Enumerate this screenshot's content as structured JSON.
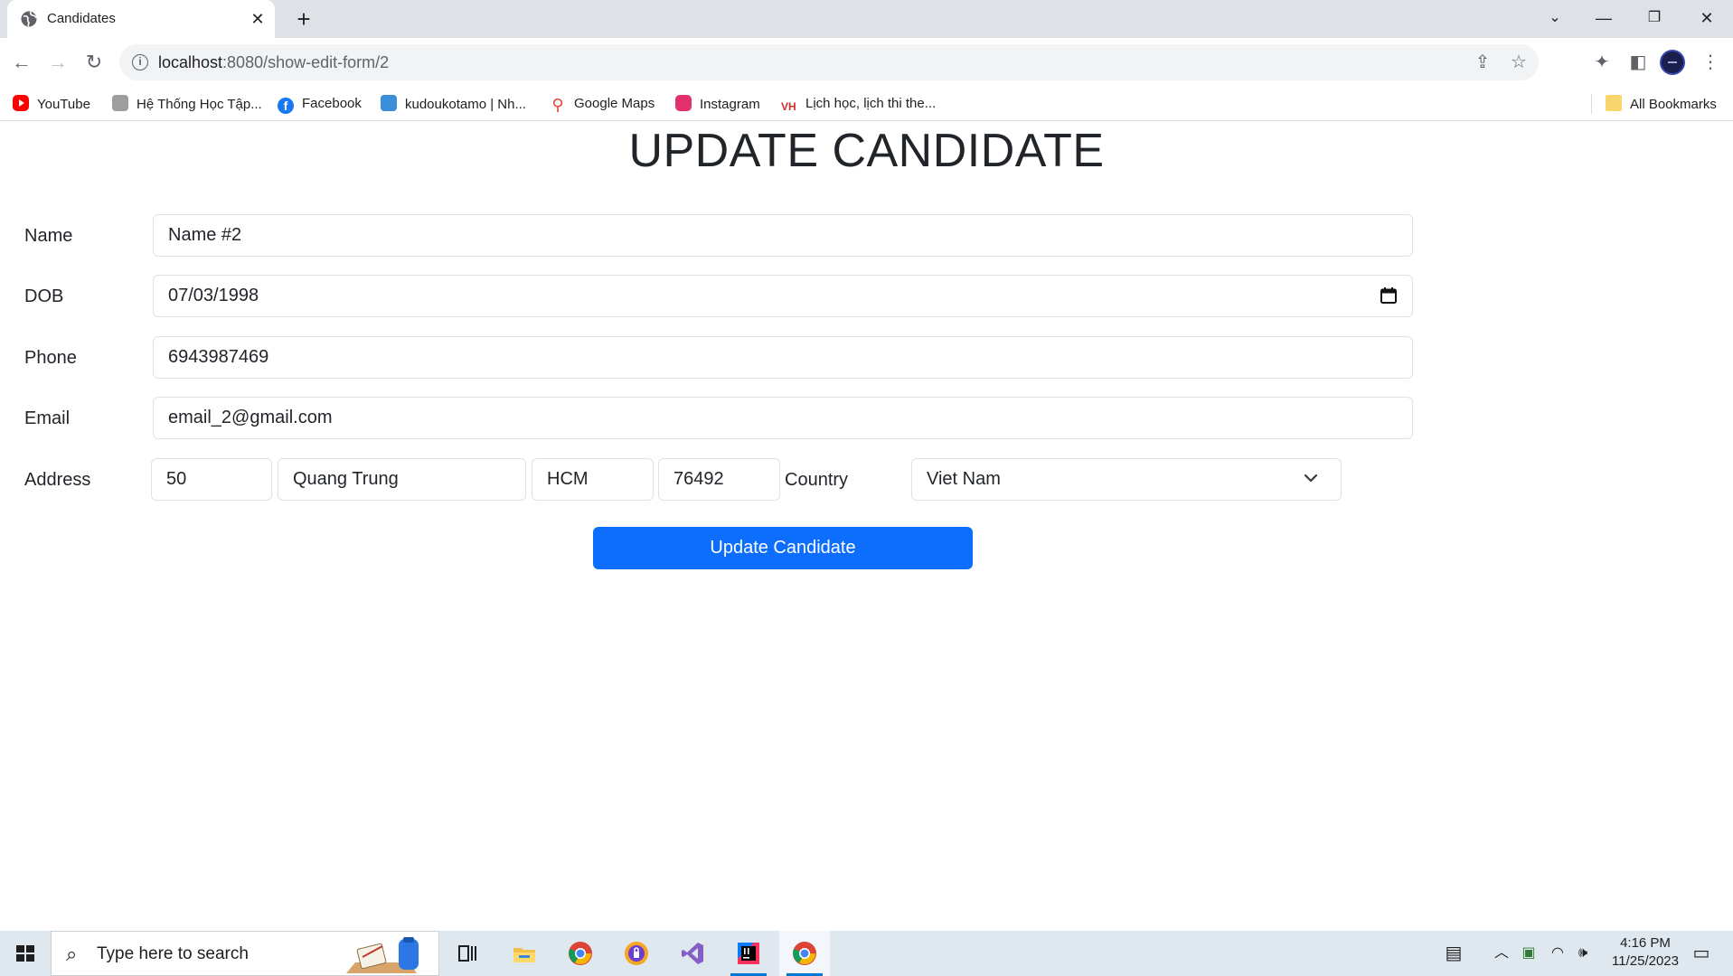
{
  "browser": {
    "tab_title": "Candidates",
    "url_host": "localhost",
    "url_rest": ":8080/show-edit-form/2",
    "bookmarks": [
      {
        "label": "YouTube",
        "icon": "youtube-icon"
      },
      {
        "label": "Hệ Thống Học Tập...",
        "icon": "school-icon"
      },
      {
        "label": "Facebook",
        "icon": "facebook-icon"
      },
      {
        "label": "kudoukotamo | Nh...",
        "icon": "kudo-icon"
      },
      {
        "label": "Google Maps",
        "icon": "map-pin-icon"
      },
      {
        "label": "Instagram",
        "icon": "instagram-icon"
      },
      {
        "label": "Lịch học, lịch thi the...",
        "icon": "schedule-icon"
      }
    ],
    "all_bookmarks_label": "All Bookmarks"
  },
  "form": {
    "title": "UPDATE CANDIDATE",
    "name_label": "Name",
    "name_value": "Name #2",
    "dob_label": "DOB",
    "dob_value": "07/03/1998",
    "phone_label": "Phone",
    "phone_value": "6943987469",
    "email_label": "Email",
    "email_value": "email_2@gmail.com",
    "address_label": "Address",
    "address_number": "50",
    "address_street": "Quang Trung",
    "address_city": "HCM",
    "address_zip": "76492",
    "country_label": "Country",
    "country_value": "Viet Nam",
    "submit_label": "Update Candidate"
  },
  "taskbar": {
    "search_placeholder": "Type here to search",
    "time": "4:16 PM",
    "date": "11/25/2023"
  },
  "colors": {
    "primary_button": "#0d6efd",
    "tab_strip": "#dee1e6",
    "taskbar": "#dfe7ef"
  }
}
